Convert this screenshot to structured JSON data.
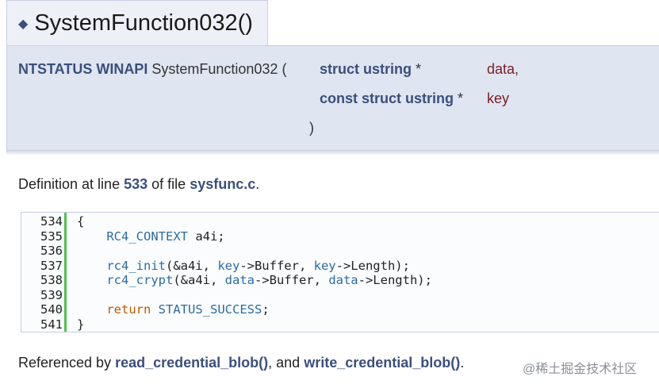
{
  "title": {
    "glyph": "◆",
    "text": "SystemFunction032()"
  },
  "prototype": {
    "return_type": "NTSTATUS WINAPI",
    "func_name": "SystemFunction032",
    "open_paren": "(",
    "param1_type": "struct ustring",
    "param1_ptr": "*",
    "param1_name": "data,",
    "param2_type": "const struct ustring",
    "param2_ptr": "*",
    "param2_name": "key",
    "close_paren": ")"
  },
  "definition": {
    "prefix": "Definition at line",
    "line": "533",
    "middle": "of file",
    "file": "sysfunc.c",
    "suffix": "."
  },
  "code": {
    "line_numbers": [
      "534",
      "535",
      "536",
      "537",
      "538",
      "539",
      "540",
      "541"
    ],
    "lines": [
      "{",
      "    RC4_CONTEXT a4i;",
      "",
      "    rc4_init(&a4i, key->Buffer, key->Length);",
      "    rc4_crypt(&a4i, data->Buffer, data->Length);",
      "",
      "    return STATUS_SUCCESS;",
      "}"
    ]
  },
  "references": {
    "prefix": "Referenced by",
    "ref1": "read_credential_blob()",
    "joiner": ", and",
    "ref2": "write_credential_blob()",
    "suffix": "."
  },
  "watermark": "@稀土掘金技术社区"
}
